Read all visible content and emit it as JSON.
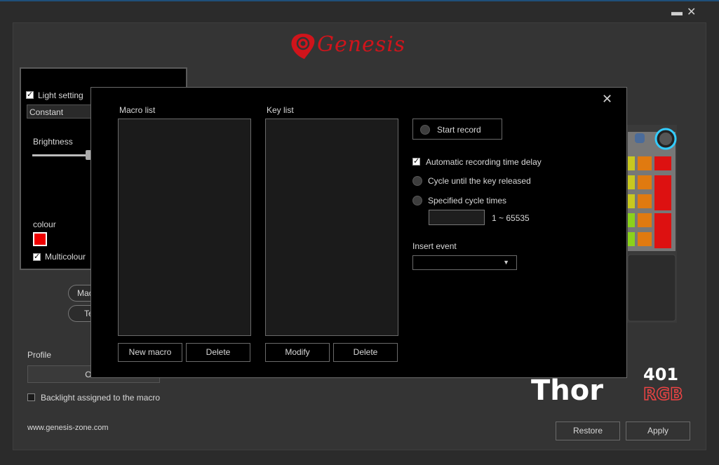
{
  "window": {
    "minimize_icon": "minimize-icon",
    "close_icon": "close-icon"
  },
  "brand": {
    "logo_text": "Genesis"
  },
  "left_panel": {
    "light_setting_label": "Light setting",
    "light_setting_checked": true,
    "mode_value": "Constant",
    "brightness_label": "Brightness",
    "colour_label": "colour",
    "colour_value": "#e00000",
    "multicolour_label": "Multicolour",
    "multicolour_checked": true
  },
  "mode_buttons": {
    "macro_partial": "Mac",
    "test_partial": "Te"
  },
  "profile": {
    "label": "Profile",
    "value": "Offic",
    "backlight_macro_label": "Backlight assigned to the macro",
    "backlight_macro_checked": false
  },
  "footer": {
    "website": "www.genesis-zone.com",
    "restore_label": "Restore",
    "apply_label": "Apply"
  },
  "product": {
    "name": "Thor",
    "model": "401",
    "suffix": "RGB"
  },
  "macro_dialog": {
    "macro_list_label": "Macro list",
    "key_list_label": "Key list",
    "new_macro_label": "New macro",
    "delete_label_1": "Delete",
    "modify_label": "Modify",
    "delete_label_2": "Delete",
    "start_record_label": "Start record",
    "auto_delay_label": "Automatic recording time delay",
    "auto_delay_checked": true,
    "cycle_release_label": "Cycle until the key released",
    "specified_cycle_label": "Specified cycle times",
    "cycle_range_label": "1 ~ 65535",
    "insert_event_label": "Insert event",
    "insert_event_value": ""
  },
  "colors": {
    "accent": "#d0141b",
    "background": "#2b2b2b",
    "modal_bg": "#000000"
  }
}
